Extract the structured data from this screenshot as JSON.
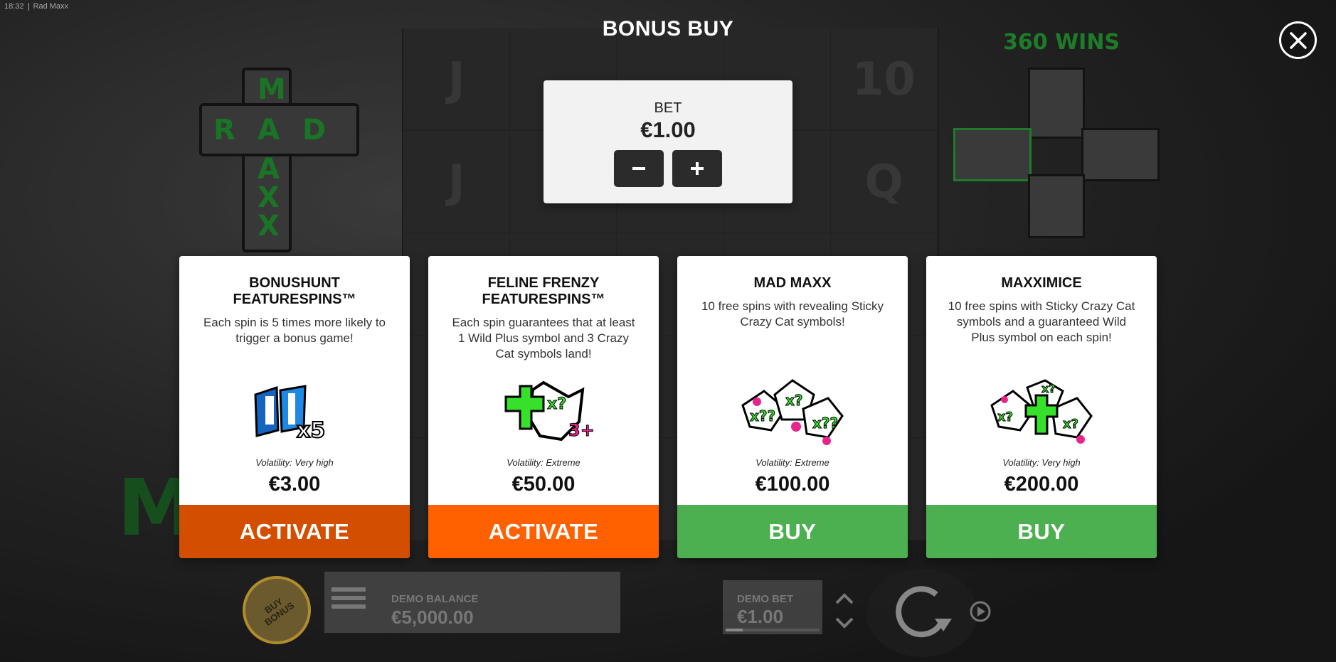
{
  "status_bar": {
    "time": "18:32",
    "app_title": "Rad Maxx"
  },
  "background": {
    "logo_letters": [
      "M",
      "R",
      "A",
      "D",
      "A",
      "X",
      "X"
    ],
    "wins_text": "360 WINS",
    "reel_symbols": [
      [
        "J",
        "",
        "",
        "",
        "10"
      ],
      [
        "J",
        "",
        "",
        "",
        "Q"
      ],
      [
        "",
        "",
        "",
        "",
        ""
      ],
      [
        "",
        "",
        "",
        "",
        ""
      ],
      [
        "",
        "",
        "",
        "",
        ""
      ]
    ],
    "accent_green": "#2fbf3f"
  },
  "dialog": {
    "title": "BONUS BUY",
    "close_icon": "close-icon"
  },
  "bet": {
    "label": "BET",
    "value": "€1.00",
    "minus_icon": "minus-icon",
    "plus_icon": "plus-icon"
  },
  "cards": [
    {
      "title": "BONUSHUNT\nFEATURESPINS™",
      "description": "Each spin is 5 times more likely to\ntrigger a bonus game!",
      "art": "fs-x5-icon",
      "art_text": "x5",
      "volatility": "Volatility: Very high",
      "price": "€3.00",
      "action": "ACTIVATE",
      "action_color": "#d44e00"
    },
    {
      "title": "FELINE FRENZY\nFEATURESPINS™",
      "description": "Each spin guarantees that at least\n1 Wild Plus symbol and 3 Crazy\nCat symbols land!",
      "art": "wild-plus-cat-icon",
      "art_text": "3+",
      "volatility": "Volatility: Extreme",
      "price": "€50.00",
      "action": "ACTIVATE",
      "action_color": "#ff6000"
    },
    {
      "title": "MAD MAXX",
      "description": "10 free spins with revealing Sticky\nCrazy Cat symbols!",
      "art": "crazy-cats-icon",
      "art_text": "",
      "volatility": "Volatility: Extreme",
      "price": "€100.00",
      "action": "BUY",
      "action_color": "#4caf50"
    },
    {
      "title": "MAXXIMICE",
      "description": "10 free spins with Sticky Crazy Cat\nsymbols and a guaranteed Wild\nPlus symbol on each spin!",
      "art": "cats-wild-plus-icon",
      "art_text": "",
      "volatility": "Volatility: Very high",
      "price": "€200.00",
      "action": "BUY",
      "action_color": "#4caf50"
    }
  ],
  "bottom_bar": {
    "buy_bonus_label": "BUY\nBONUS",
    "balance_label": "DEMO BALANCE",
    "balance_value": "€5,000.00",
    "bet_label": "DEMO BET",
    "bet_value": "€1.00",
    "bet_level": 0.18,
    "menu_icon": "menu-icon",
    "spin_icon": "spin-icon",
    "autoplay_icon": "autoplay-icon"
  }
}
